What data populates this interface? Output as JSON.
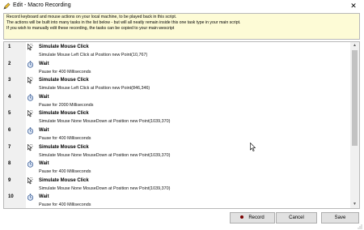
{
  "window": {
    "title": "Edit - Macro Recording",
    "close_glyph": "✕"
  },
  "info": {
    "lines": [
      "Record keyboard and mouse actions on your local machine, to be played back in this script.",
      "The actions will be built into many tasks in the list below - but will all neatly remain inside this one task type in your main script.",
      "If you wish to manually edit these recording, the tasks can be copied to your main wescript"
    ]
  },
  "tasks": [
    {
      "num": "1",
      "icon": "mouse-cursor-icon",
      "title": "Simulate Mouse Click",
      "desc": "Simulate Mouse Left Click at Position new Point(10,767)"
    },
    {
      "num": "2",
      "icon": "stopwatch-icon",
      "title": "Wait",
      "desc": "Pause for 400 Milliseconds"
    },
    {
      "num": "3",
      "icon": "mouse-cursor-icon",
      "title": "Simulate Mouse Click",
      "desc": "Simulate Mouse Left Click at Position new Point(846,346)"
    },
    {
      "num": "4",
      "icon": "stopwatch-icon",
      "title": "Wait",
      "desc": "Pause for 2000 Milliseconds"
    },
    {
      "num": "5",
      "icon": "mouse-cursor-icon",
      "title": "Simulate Mouse Click",
      "desc": "Simulate Mouse None MouseDown at Position new Point(1039,370)"
    },
    {
      "num": "6",
      "icon": "stopwatch-icon",
      "title": "Wait",
      "desc": "Pause for 400 Milliseconds"
    },
    {
      "num": "7",
      "icon": "mouse-cursor-icon",
      "title": "Simulate Mouse Click",
      "desc": "Simulate Mouse None MouseDown at Position new Point(1039,370)"
    },
    {
      "num": "8",
      "icon": "stopwatch-icon",
      "title": "Wait",
      "desc": "Pause for 400 Milliseconds"
    },
    {
      "num": "9",
      "icon": "mouse-cursor-icon",
      "title": "Simulate Mouse Click",
      "desc": "Simulate Mouse None MouseDown at Position new Point(1039,370)"
    },
    {
      "num": "10",
      "icon": "stopwatch-icon",
      "title": "Wait",
      "desc": "Pause for 400 Milliseconds"
    }
  ],
  "buttons": {
    "record": "Record",
    "cancel": "Cancel",
    "save": "Save"
  },
  "colors": {
    "info_background": "#fdfbd6",
    "gutter": "#f0f0f0",
    "record_dot": "#7a0000"
  }
}
